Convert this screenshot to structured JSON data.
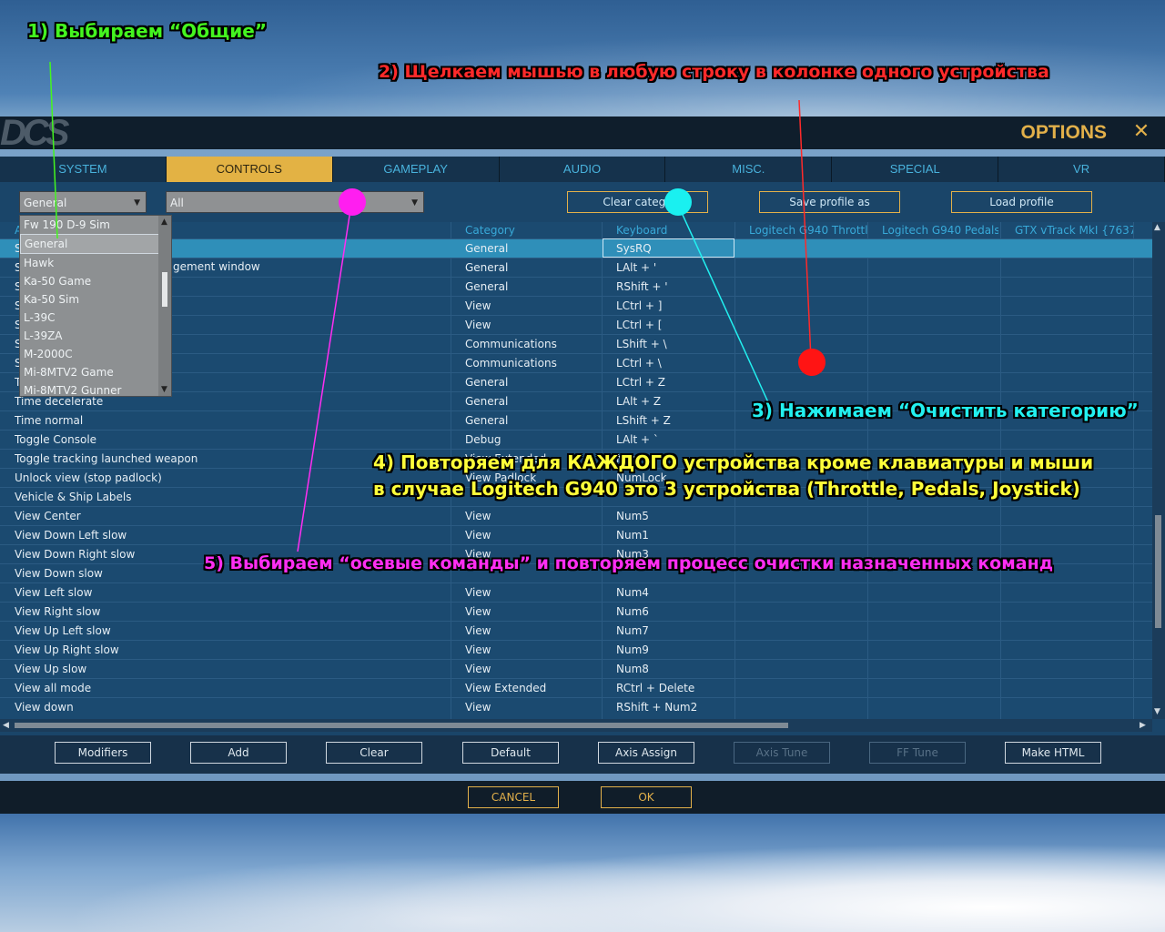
{
  "window": {
    "title": "OPTIONS",
    "close_icon": "close-icon"
  },
  "tabs": [
    {
      "label": "SYSTEM",
      "active": false
    },
    {
      "label": "CONTROLS",
      "active": true
    },
    {
      "label": "GAMEPLAY",
      "active": false
    },
    {
      "label": "AUDIO",
      "active": false
    },
    {
      "label": "MISC.",
      "active": false
    },
    {
      "label": "SPECIAL",
      "active": false
    },
    {
      "label": "VR",
      "active": false
    }
  ],
  "toolbar": {
    "aircraft_select": "General",
    "category_select": "All",
    "clear_category": "Clear catego",
    "save_profile": "Save profile as",
    "load_profile": "Load profile"
  },
  "dropdown": {
    "items": [
      "Fw 190 D-9 Sim",
      "General",
      "Hawk",
      "Ka-50 Game",
      "Ka-50 Sim",
      "L-39C",
      "L-39ZA",
      "M-2000C",
      "Mi-8MTV2 Game",
      "Mi-8MTV2 Gunner"
    ],
    "selected": "General"
  },
  "table": {
    "headers": {
      "action": "A",
      "category": "Category",
      "keyboard": "Keyboard",
      "dev1": "Logitech G940 Throttle",
      "dev2": "Logitech G940 Pedals",
      "dev3": "GTX vTrack MkI {7637."
    },
    "rows": [
      {
        "action": "S",
        "category": "General",
        "keyboard": "SysRQ"
      },
      {
        "action": "S",
        "category": "General",
        "keyboard": "LAlt + '"
      },
      {
        "action": "S",
        "category": "General",
        "keyboard": "RShift + '"
      },
      {
        "action": "S",
        "category": "View",
        "keyboard": "LCtrl + ]"
      },
      {
        "action": "S",
        "category": "View",
        "keyboard": "LCtrl + ["
      },
      {
        "action": "S",
        "category": "Communications",
        "keyboard": "LShift + \\"
      },
      {
        "action": "S",
        "category": "Communications",
        "keyboard": "LCtrl + \\"
      },
      {
        "action": "T",
        "category": "General",
        "keyboard": "LCtrl + Z"
      },
      {
        "action": "Time decelerate",
        "category": "General",
        "keyboard": "LAlt + Z"
      },
      {
        "action": "Time normal",
        "category": "General",
        "keyboard": "LShift + Z"
      },
      {
        "action": "Toggle Console",
        "category": "Debug",
        "keyboard": "LAlt + `"
      },
      {
        "action": "Toggle tracking launched weapon",
        "category": "View Extended",
        "keyboard": "Num"
      },
      {
        "action": "Unlock view (stop padlock)",
        "category": "View Padlock",
        "keyboard": "NumLock"
      },
      {
        "action": "Vehicle & Ship Labels",
        "category": "",
        "keyboard": ""
      },
      {
        "action": "View Center",
        "category": "View",
        "keyboard": "Num5"
      },
      {
        "action": "View Down Left slow",
        "category": "View",
        "keyboard": "Num1"
      },
      {
        "action": "View Down Right slow",
        "category": "View",
        "keyboard": "Num3"
      },
      {
        "action": "View Down slow",
        "category": "",
        "keyboard": ""
      },
      {
        "action": "View Left slow",
        "category": "View",
        "keyboard": "Num4"
      },
      {
        "action": "View Right slow",
        "category": "View",
        "keyboard": "Num6"
      },
      {
        "action": "View Up Left slow",
        "category": "View",
        "keyboard": "Num7"
      },
      {
        "action": "View Up Right slow",
        "category": "View",
        "keyboard": "Num9"
      },
      {
        "action": "View Up slow",
        "category": "View",
        "keyboard": "Num8"
      },
      {
        "action": "View all mode",
        "category": "View Extended",
        "keyboard": "RCtrl + Delete"
      },
      {
        "action": "View down",
        "category": "View",
        "keyboard": "RShift + Num2"
      }
    ],
    "partial_row_fragment": "gement window"
  },
  "buttons": {
    "modifiers": "Modifiers",
    "add": "Add",
    "clear": "Clear",
    "default": "Default",
    "axis_assign": "Axis Assign",
    "axis_tune": "Axis Tune",
    "ff_tune": "FF Tune",
    "make_html": "Make HTML",
    "cancel": "CANCEL",
    "ok": "OK"
  },
  "annotations": {
    "step1": "1) Выбираем “Общие”",
    "step2": "2) Щелкаем мышью в любую строку в колонке одного устройства",
    "step3": "3) Нажимаем “Очистить категорию”",
    "step4_line1": "4) Повторяем для КАЖДОГО устройства кроме клавиатуры и мыши",
    "step4_line2": "в случае Logitech G940 это 3 устройства (Throttle, Pedals, Joystick)",
    "step5": "5) Выбираем “осевые команды” и повторяем процесс очистки назначенных команд"
  },
  "colors": {
    "accent": "#e3b244",
    "tab_text": "#49b3dd",
    "selected_row": "#2f8fb9",
    "ann_green": "#44f51f",
    "ann_red": "#ff2a2a",
    "ann_cyan": "#22f0f0",
    "ann_yellow": "#ffff3a",
    "ann_magenta": "#ff2ef2"
  }
}
